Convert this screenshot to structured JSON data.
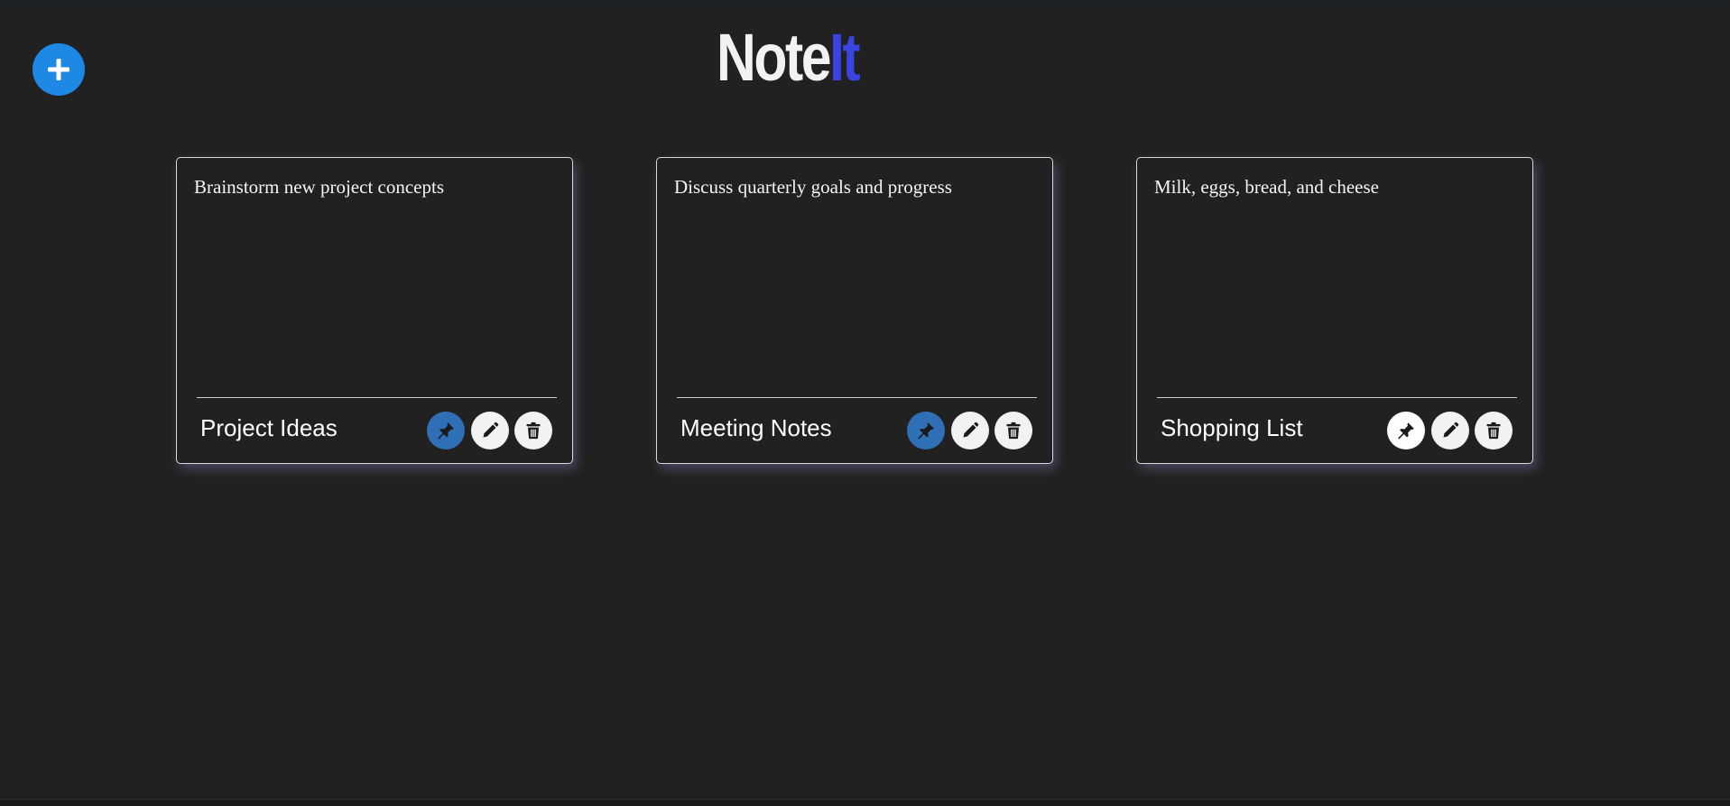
{
  "app": {
    "logo_part1": "Note",
    "logo_part2": "It"
  },
  "colors": {
    "background": "#212121",
    "accent_blue": "#1e88e5",
    "logo_white": "#f2f2f2",
    "logo_blue": "#3a45e0",
    "pinned_blue": "#2f6fb5",
    "button_light": "#f2f2f2",
    "card_border": "#d8d8de"
  },
  "toolbar": {
    "add_icon": "plus-icon"
  },
  "notes": [
    {
      "content": "Brainstorm new project concepts",
      "title": "Project Ideas",
      "pinned": true
    },
    {
      "content": "Discuss quarterly goals and progress",
      "title": "Meeting Notes",
      "pinned": true
    },
    {
      "content": "Milk, eggs, bread, and cheese",
      "title": "Shopping List",
      "pinned": false
    }
  ],
  "card_actions": {
    "pin_icon": "pin-icon",
    "edit_icon": "pencil-icon",
    "delete_icon": "trash-icon"
  }
}
